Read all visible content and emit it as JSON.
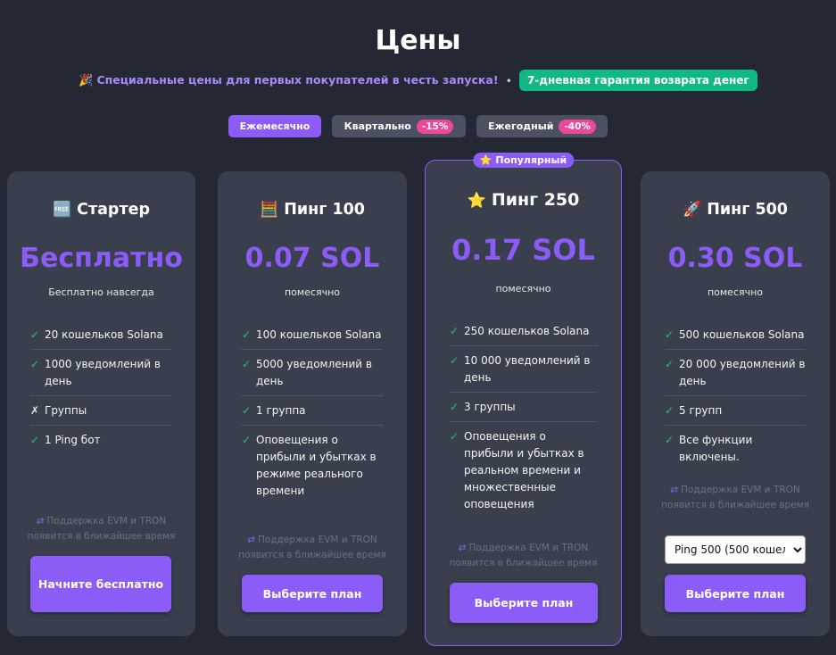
{
  "header": {
    "title": "Цены",
    "promo_emoji": "🎉",
    "promo_text": "Специальные цены для первых покупателей в честь запуска!",
    "promo_separator": "•",
    "guarantee": "7-дневная гарантия возврата денег"
  },
  "billing": {
    "monthly": "Ежемесячно",
    "quarterly": "Квартально",
    "quarterly_badge": "-15%",
    "yearly": "Ежегодный",
    "yearly_badge": "-40%",
    "active": "monthly"
  },
  "plans": [
    {
      "emoji": "🆓",
      "name": "Стартер",
      "price": "Бесплатно",
      "period": "Бесплатно навсегда",
      "features": [
        {
          "mark": "✓",
          "text": "20 кошельков Solana"
        },
        {
          "mark": "✓",
          "text": "1000 уведомлений в день"
        },
        {
          "mark": "✗",
          "text": "Группы"
        },
        {
          "mark": "✓",
          "text": "1 Ping бот"
        }
      ],
      "support_line1": "Поддержка EVM и TRON",
      "support_line2": "появится в ближайшее время",
      "cta": "Начните бесплатно"
    },
    {
      "emoji": "🧮",
      "name": "Пинг 100",
      "price": "0.07 SOL",
      "period": "помесячно",
      "features": [
        {
          "mark": "✓",
          "text": "100 кошельков Solana"
        },
        {
          "mark": "✓",
          "text": "5000 уведомлений в день"
        },
        {
          "mark": "✓",
          "text": "1 группа"
        },
        {
          "mark": "✓",
          "text": "Оповещения о прибыли и убытках в режиме реального времени"
        }
      ],
      "support_line1": "Поддержка EVM и TRON",
      "support_line2": "появится в ближайшее время",
      "cta": "Выберите план"
    },
    {
      "badge": "⭐ Популярный",
      "emoji": "⭐",
      "name": "Пинг 250",
      "price": "0.17 SOL",
      "period": "помесячно",
      "features": [
        {
          "mark": "✓",
          "text": "250 кошельков Solana"
        },
        {
          "mark": "✓",
          "text": "10 000 уведомлений в день"
        },
        {
          "mark": "✓",
          "text": "3 группы"
        },
        {
          "mark": "✓",
          "text": "Оповещения о прибыли и убытках в реальном времени и множественные оповещения"
        }
      ],
      "support_line1": "Поддержка EVM и TRON",
      "support_line2": "появится в ближайшее время",
      "cta": "Выберите план"
    },
    {
      "emoji": "🚀",
      "name": "Пинг 500",
      "price": "0.30 SOL",
      "period": "помесячно",
      "features": [
        {
          "mark": "✓",
          "text": "500 кошельков Solana"
        },
        {
          "mark": "✓",
          "text": "20 000 уведомлений в день"
        },
        {
          "mark": "✓",
          "text": "5 групп"
        },
        {
          "mark": "✓",
          "text": "Все функции включены."
        }
      ],
      "support_line1": "Поддержка EVM и TRON",
      "support_line2": "появится в ближайшее время",
      "select_value": "Ping 500 (500 кошелы",
      "cta": "Выберите план"
    }
  ],
  "colors": {
    "background": "#232834",
    "card": "#3a3f4d",
    "accent": "#8b5cf6",
    "success": "#10b981",
    "discount": "#ec4899"
  }
}
